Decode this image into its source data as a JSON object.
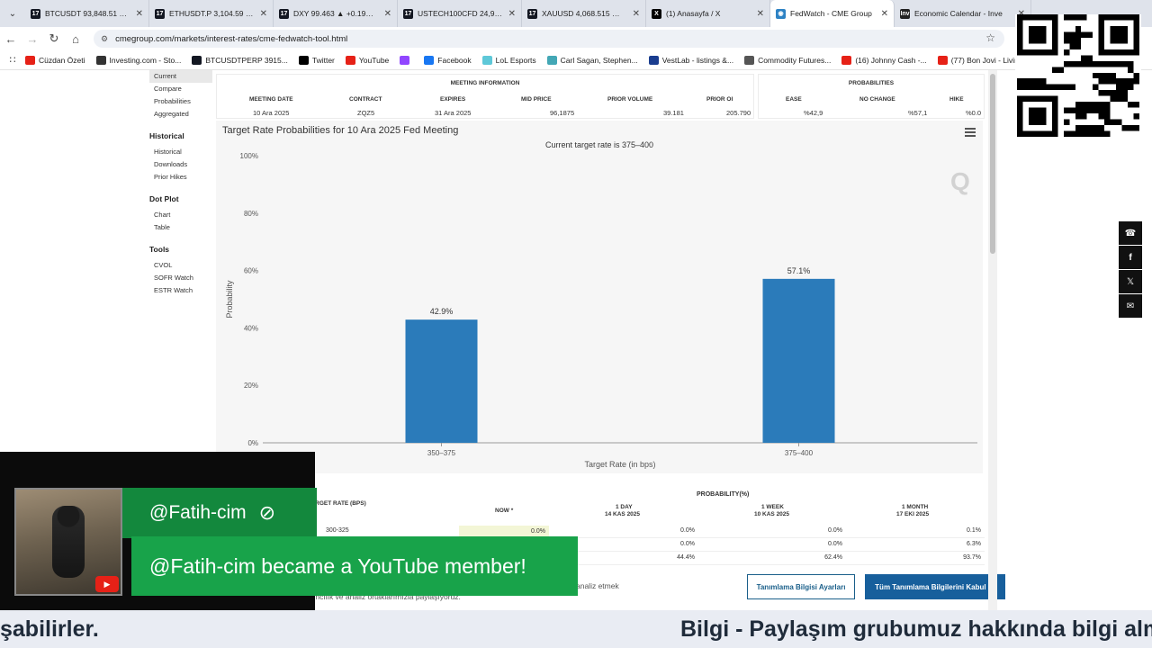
{
  "tabs": [
    {
      "title": "BTCUSDT 93,848.51 ▼ −0.",
      "fav": "tv",
      "active": false
    },
    {
      "title": "ETHUSDT.P 3,104.59 ▲ +",
      "fav": "tv",
      "active": false
    },
    {
      "title": "DXY 99.463 ▲ +0.19% Un",
      "fav": "tv",
      "active": false
    },
    {
      "title": "USTECH100CFD 24,963.0",
      "fav": "tv",
      "active": false
    },
    {
      "title": "XAUUSD 4,068.515 ▼ −0.",
      "fav": "tv",
      "active": false
    },
    {
      "title": "(1) Anasayfa / X",
      "fav": "x",
      "active": false
    },
    {
      "title": "FedWatch - CME Group",
      "fav": "cme",
      "active": true
    },
    {
      "title": "Economic Calendar - Inve",
      "fav": "inv",
      "active": false
    }
  ],
  "address": "cmegroup.com/markets/interest-rates/cme-fedwatch-tool.html",
  "bookmarks": [
    {
      "label": "Cüzdan Özeti",
      "color": "#e62117"
    },
    {
      "label": "Investing.com - Sto...",
      "color": "#333333"
    },
    {
      "label": "BTCUSDTPERP 3915...",
      "color": "#131722"
    },
    {
      "label": "Twitter",
      "color": "#000000"
    },
    {
      "label": "YouTube",
      "color": "#e62117"
    },
    {
      "label": "",
      "color": "#9146ff"
    },
    {
      "label": "Facebook",
      "color": "#1877f2"
    },
    {
      "label": "LoL Esports",
      "color": "#5ec8d8"
    },
    {
      "label": "Carl Sagan, Stephen...",
      "color": "#43a7b5"
    },
    {
      "label": "VestLab - listings &...",
      "color": "#1a3d8f"
    },
    {
      "label": "Commodity Futures...",
      "color": "#555555"
    },
    {
      "label": "(16) Johnny Cash -...",
      "color": "#e62117"
    },
    {
      "label": "(77) Bon Jovi - Livin...",
      "color": "#e62117"
    }
  ],
  "sidenav": {
    "top_items": [
      "Current",
      "Compare",
      "Probabilities",
      "Aggregated"
    ],
    "historical_title": "Historical",
    "historical_items": [
      "Historical",
      "Downloads",
      "Prior Hikes"
    ],
    "dotplot_title": "Dot Plot",
    "dotplot_items": [
      "Chart",
      "Table"
    ],
    "tools_title": "Tools",
    "tools_items": [
      "CVOL",
      "SOFR Watch",
      "ESTR Watch"
    ]
  },
  "meeting": {
    "group_label": "MEETING INFORMATION",
    "headers": [
      "MEETING DATE",
      "CONTRACT",
      "EXPIRES",
      "MID PRICE",
      "PRIOR VOLUME",
      "PRIOR OI"
    ],
    "values": [
      "10 Ara 2025",
      "ZQZ5",
      "31 Ara 2025",
      "96,1875",
      "39.181",
      "205.790"
    ]
  },
  "probabilities": {
    "group_label": "PROBABILITIES",
    "headers": [
      "EASE",
      "NO CHANGE",
      "HIKE"
    ],
    "values": [
      "%42,9",
      "%57,1",
      "%0.0"
    ]
  },
  "chart_data": {
    "type": "bar",
    "title": "Target Rate Probabilities for 10 Ara 2025 Fed Meeting",
    "subtitle": "Current target rate is 375–400",
    "categories": [
      "350–375",
      "375–400"
    ],
    "values": [
      42.9,
      57.1
    ],
    "data_labels": [
      "42.9%",
      "57.1%"
    ],
    "xlabel": "Target Rate (in bps)",
    "ylabel": "Probability",
    "ylim": [
      0,
      100
    ],
    "yticks": [
      "0%",
      "20%",
      "40%",
      "60%",
      "80%",
      "100%"
    ],
    "grid": false,
    "color": "#2b7bba"
  },
  "prob_table": {
    "header_main": "PROBABILITY(%)",
    "col_target": "TARGET RATE (BPS)",
    "col_now": "NOW *",
    "col_1day": "1 DAY",
    "col_1day_date": "14 KAS 2025",
    "col_1week": "1 WEEK",
    "col_1week_date": "10 KAS 2025",
    "col_1month": "1 MONTH",
    "col_1month_date": "17 EKI 2025",
    "rows": [
      {
        "rate": "300-325",
        "now": "0.0%",
        "d1": "0.0%",
        "w1": "0.0%",
        "m1": "0.1%"
      },
      {
        "rate": "",
        "now": "",
        "d1": "0.0%",
        "w1": "0.0%",
        "m1": "6.3%"
      },
      {
        "rate": "",
        "now": "",
        "d1": "44.4%",
        "w1": "62.4%",
        "m1": "93.7%"
      }
    ]
  },
  "cookie": {
    "text1": "analiz etmek",
    "text2": "mcılık ve analiz ortaklarımızla paylaşıyoruz.",
    "settings_button": "Tanımlama Bilgisi Ayarları",
    "accept_button": "Tüm Tanımlama Bilgilerini Kabul Et"
  },
  "stream": {
    "handle": "@Fatih-cim",
    "member_message": "@Fatih-cim became a YouTube member!"
  },
  "ticker": {
    "left": "şabilirler.",
    "right": "Bilgi - Paylaşım grubumuz hakkında bilgi alm"
  }
}
